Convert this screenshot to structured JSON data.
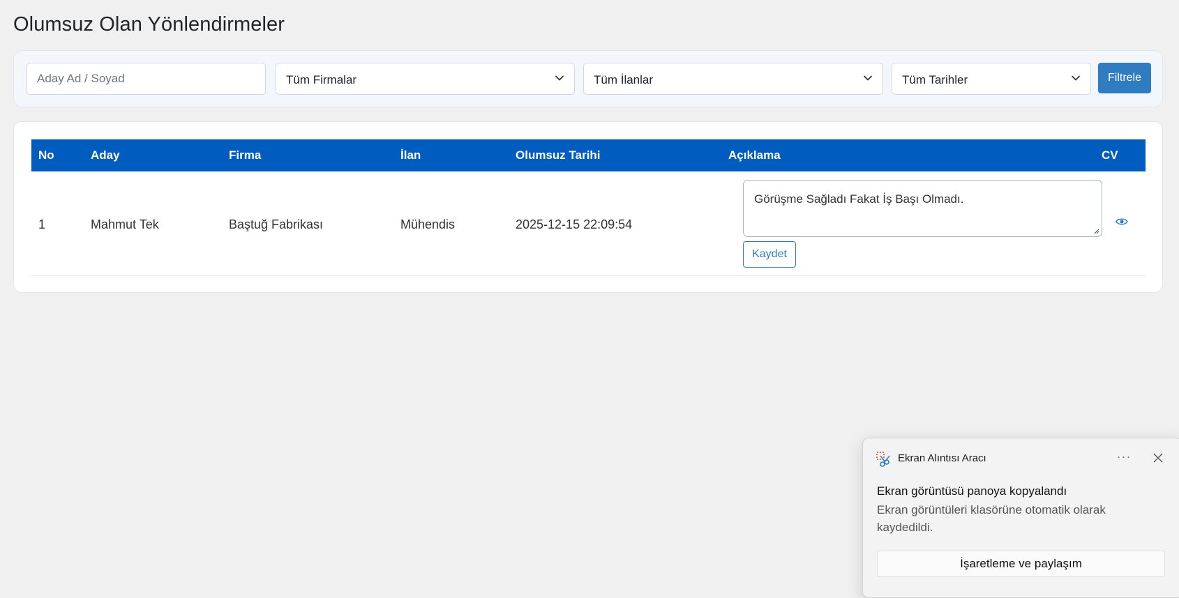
{
  "page": {
    "title": "Olumsuz Olan Yönlendirmeler"
  },
  "filters": {
    "candidate_placeholder": "Aday Ad / Soyad",
    "candidate_value": "",
    "company_selected": "Tüm Firmalar",
    "listing_selected": "Tüm İlanlar",
    "date_selected": "Tüm Tarihler",
    "filter_button": "Filtrele"
  },
  "table": {
    "headers": [
      "No",
      "Aday",
      "Firma",
      "İlan",
      "Olumsuz Tarihi",
      "Açıklama",
      "CV"
    ],
    "rows": [
      {
        "no": "1",
        "candidate": "Mahmut Tek",
        "company": "Baştuğ Fabrikası",
        "listing": "Mühendis",
        "date": "2025-12-15 22:09:54",
        "note": "Görüşme Sağladı Fakat İş Başı Olmadı.",
        "save_label": "Kaydet",
        "cv_icon": "eye-icon"
      }
    ]
  },
  "colors": {
    "header_bg": "#005cbf",
    "primary_button": "#2f7dc0",
    "page_bg": "#f0f0f0"
  },
  "toast": {
    "app_name": "Ekran Alıntısı Aracı",
    "more_label": "···",
    "title": "Ekran görüntüsü panoya kopyalandı",
    "body": "Ekran görüntüleri klasörüne otomatik olarak kaydedildi.",
    "action_label": "İşaretleme ve paylaşım"
  }
}
